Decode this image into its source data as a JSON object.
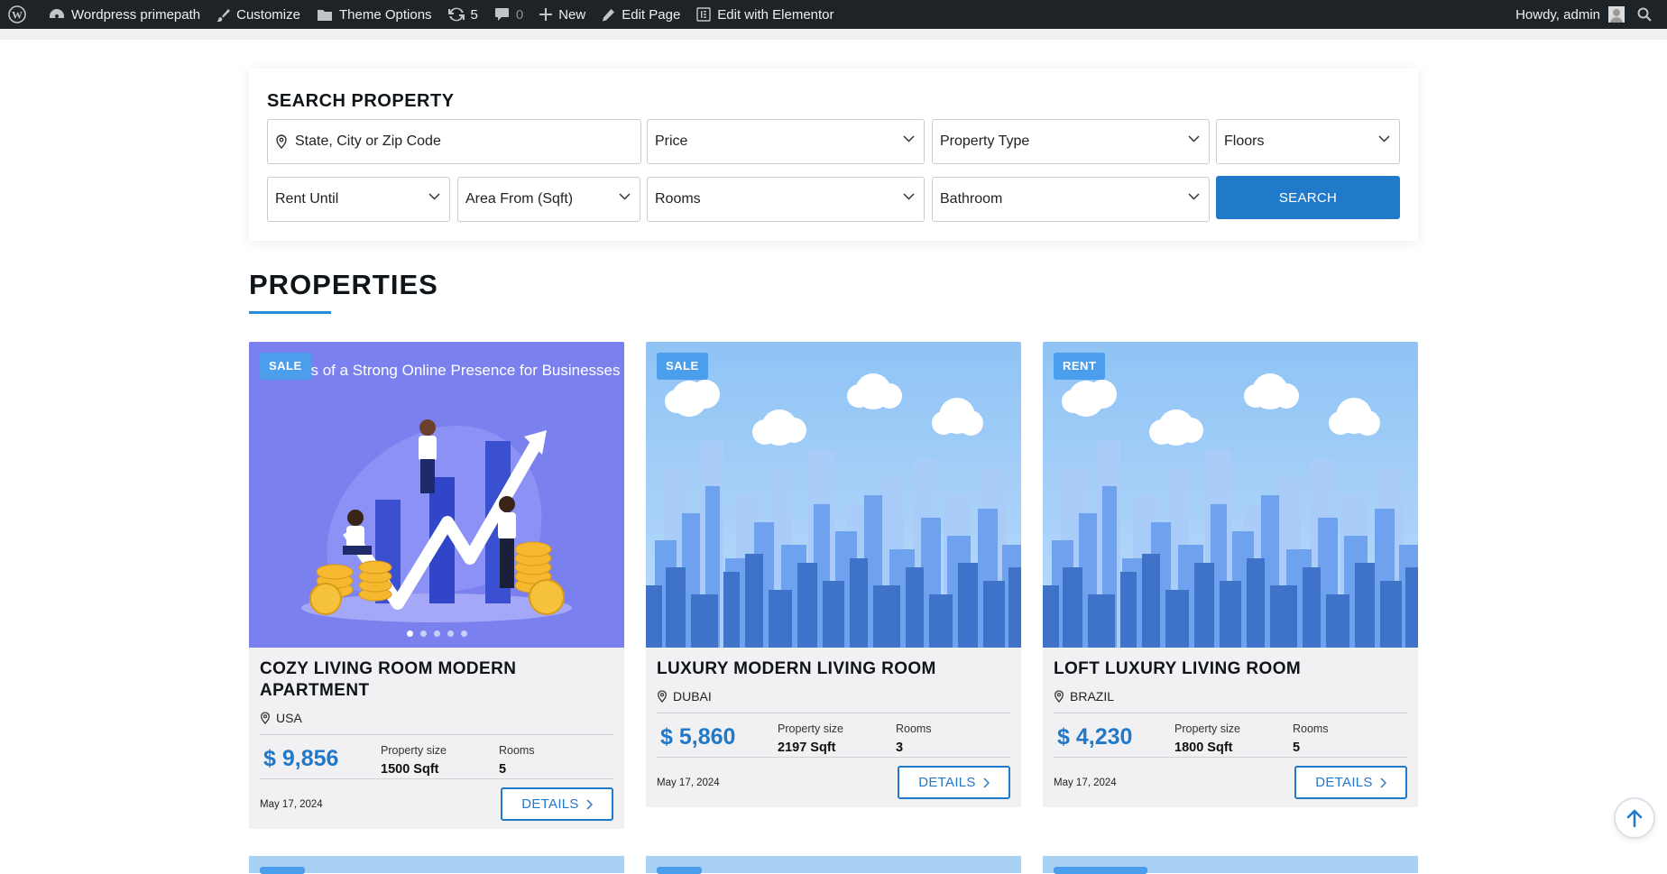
{
  "admin_bar": {
    "site_name": "Wordpress primepath",
    "customize": "Customize",
    "theme_options": "Theme Options",
    "updates_count": "5",
    "comments_count": "0",
    "new": "New",
    "edit_page": "Edit Page",
    "edit_elementor": "Edit with Elementor",
    "howdy": "Howdy, admin"
  },
  "search": {
    "title": "SEARCH PROPERTY",
    "location_placeholder": "State, City or Zip Code",
    "price": "Price",
    "property_type": "Property Type",
    "floors": "Floors",
    "rent_until": "Rent Until",
    "area_from": "Area From (Sqft)",
    "rooms": "Rooms",
    "bathroom": "Bathroom",
    "button": "SEARCH"
  },
  "properties": {
    "heading": "PROPERTIES",
    "size_label": "Property size",
    "rooms_label": "Rooms",
    "details_label": "DETAILS",
    "items": [
      {
        "badge": "SALE",
        "image_caption": "its of a Strong Online Presence for Businesses",
        "title": "COZY LIVING ROOM MODERN APARTMENT",
        "location": "USA",
        "price": "$ 9,856",
        "size": "1500 Sqft",
        "rooms": "5",
        "date": "May 17, 2024"
      },
      {
        "badge": "SALE",
        "title": "LUXURY MODERN LIVING ROOM",
        "location": "DUBAI",
        "price": "$ 5,860",
        "size": "2197 Sqft",
        "rooms": "3",
        "date": "May 17, 2024"
      },
      {
        "badge": "RENT",
        "title": "LOFT LUXURY LIVING ROOM",
        "location": "BRAZIL",
        "price": "$ 4,230",
        "size": "1800 Sqft",
        "rooms": "5",
        "date": "May 17, 2024"
      }
    ]
  },
  "colors": {
    "accent": "#2079c9",
    "badge": "#4a9eec",
    "adminbar": "#1d2327"
  }
}
